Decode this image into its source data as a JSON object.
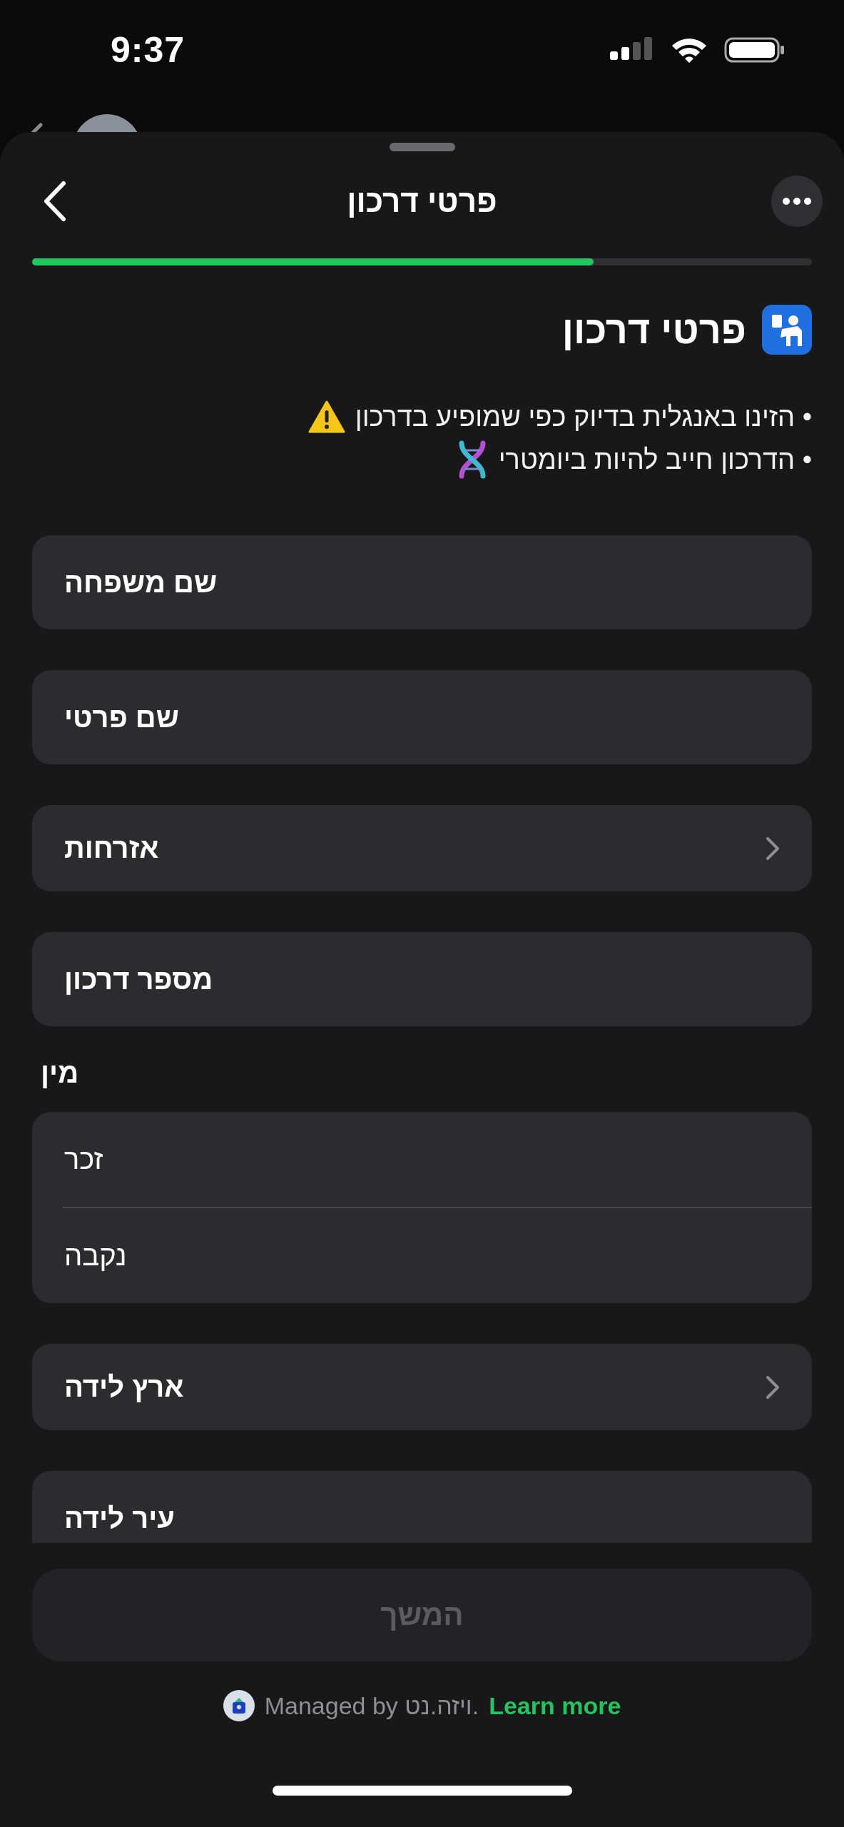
{
  "status_bar": {
    "time": "9:37"
  },
  "nav": {
    "title": "פרטי דרכון"
  },
  "progress": {
    "level": 0.72
  },
  "heading": "פרטי דרכון",
  "notes": [
    {
      "text": "• הזינו באנגלית בדיוק כפי שמופיע בדרכון",
      "kind": "warning"
    },
    {
      "text": "• הדרכון חייב להיות ביומטרי",
      "kind": "dna"
    }
  ],
  "form": [
    {
      "kind": "text",
      "placeholder": "שם משפחה"
    },
    {
      "kind": "text",
      "placeholder": "שם פרטי"
    },
    {
      "kind": "picker",
      "label": "אזרחות"
    },
    {
      "kind": "text",
      "placeholder": "מספר דרכון"
    },
    {
      "kind": "choice",
      "label": "מין",
      "options": [
        {
          "label": "זכר",
          "selected": false
        },
        {
          "label": "נקבה",
          "selected": false
        }
      ]
    },
    {
      "kind": "picker",
      "label": "ארץ לידה"
    },
    {
      "kind": "text",
      "placeholder": "עיר לידה"
    }
  ],
  "continue_button": {
    "label": "המשך",
    "disabled": true
  },
  "footer": {
    "text": "Managed by ויזה.נט.",
    "link": "Learn more"
  }
}
